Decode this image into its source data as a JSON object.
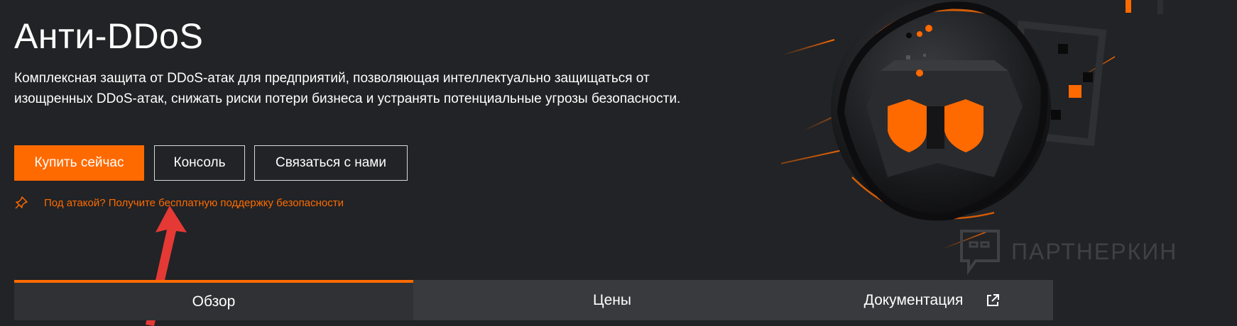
{
  "hero": {
    "title": "Анти-DDoS",
    "description": "Комплексная защита от DDoS-атак для предприятий, позволяющая интеллектуально защищаться от изощренных DDoS-атак, снижать риски потери бизнеса и устранять потенциальные угрозы безопасности."
  },
  "buttons": {
    "buy": "Купить сейчас",
    "console": "Консоль",
    "contact": "Связаться с нами"
  },
  "attack_link": {
    "icon": "pin-icon",
    "text": "Под атакой? Получите бесплатную поддержку безопасности"
  },
  "tabs": [
    {
      "label": "Обзор",
      "active": true
    },
    {
      "label": "Цены",
      "active": false
    },
    {
      "label": "Документация",
      "active": false,
      "icon": "external-link-icon"
    }
  ],
  "watermark": {
    "text": "ПАРТНЕРКИН"
  },
  "colors": {
    "background": "#212326",
    "accent": "#ff6a00",
    "tab_bar": "#383a3d",
    "annotation_arrow": "#e53935"
  }
}
